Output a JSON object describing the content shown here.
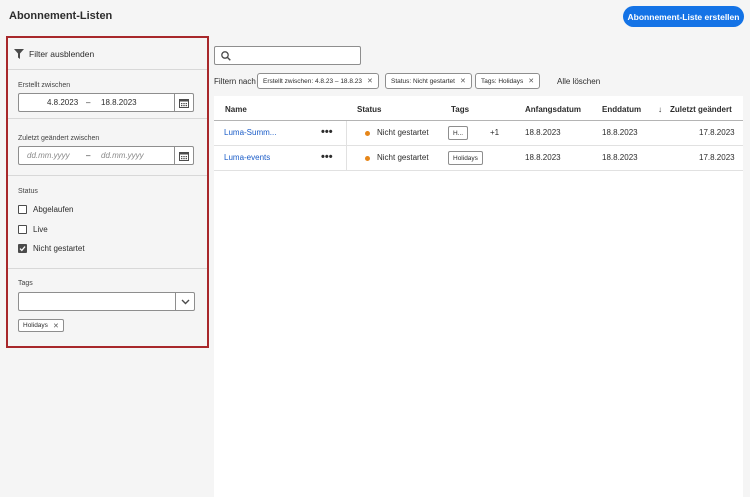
{
  "header": {
    "title": "Abonnement-Listen",
    "create_button": "Abonnement-Liste erstellen"
  },
  "filter_panel": {
    "hide_label": "Filter ausblenden",
    "created_between": {
      "label": "Erstellt zwischen",
      "from": "4.8.2023",
      "to": "18.8.2023",
      "separator": "–"
    },
    "modified_between": {
      "label": "Zuletzt geändert zwischen",
      "from_placeholder": "dd.mm.yyyy",
      "to_placeholder": "dd.mm.yyyy",
      "separator": "–"
    },
    "status": {
      "label": "Status",
      "options": [
        {
          "label": "Abgelaufen",
          "checked": false
        },
        {
          "label": "Live",
          "checked": false
        },
        {
          "label": "Nicht gestartet",
          "checked": true
        }
      ]
    },
    "tags": {
      "label": "Tags",
      "value": "",
      "selected": [
        "Holidays"
      ]
    }
  },
  "search": {
    "placeholder": ""
  },
  "filter_bar": {
    "label": "Filtern nach",
    "chips": [
      "Erstellt zwischen:  4.8.23 –  18.8.23",
      "Status: Nicht gestartet",
      "Tags: Holidays"
    ],
    "clear_all": "Alle löschen"
  },
  "table": {
    "columns": [
      "Name",
      "Status",
      "Tags",
      "Anfangsdatum",
      "Enddatum",
      "Zuletzt geändert"
    ],
    "sort_indicator": "↓",
    "rows": [
      {
        "name": "Luma-Summ...",
        "status": "Nicht gestartet",
        "tag": "H...",
        "extra_tags": "+1",
        "start": "18.8.2023",
        "end": "18.8.2023",
        "modified": "17.8.2023"
      },
      {
        "name": "Luma-events",
        "status": "Nicht gestartet",
        "tag": "Holidays",
        "extra_tags": "",
        "start": "18.8.2023",
        "end": "18.8.2023",
        "modified": "17.8.2023"
      }
    ]
  },
  "colors": {
    "accent": "#1473e6",
    "link": "#1a5cc8",
    "status_not_started": "#e68619",
    "panel_highlight": "#a8282b"
  }
}
